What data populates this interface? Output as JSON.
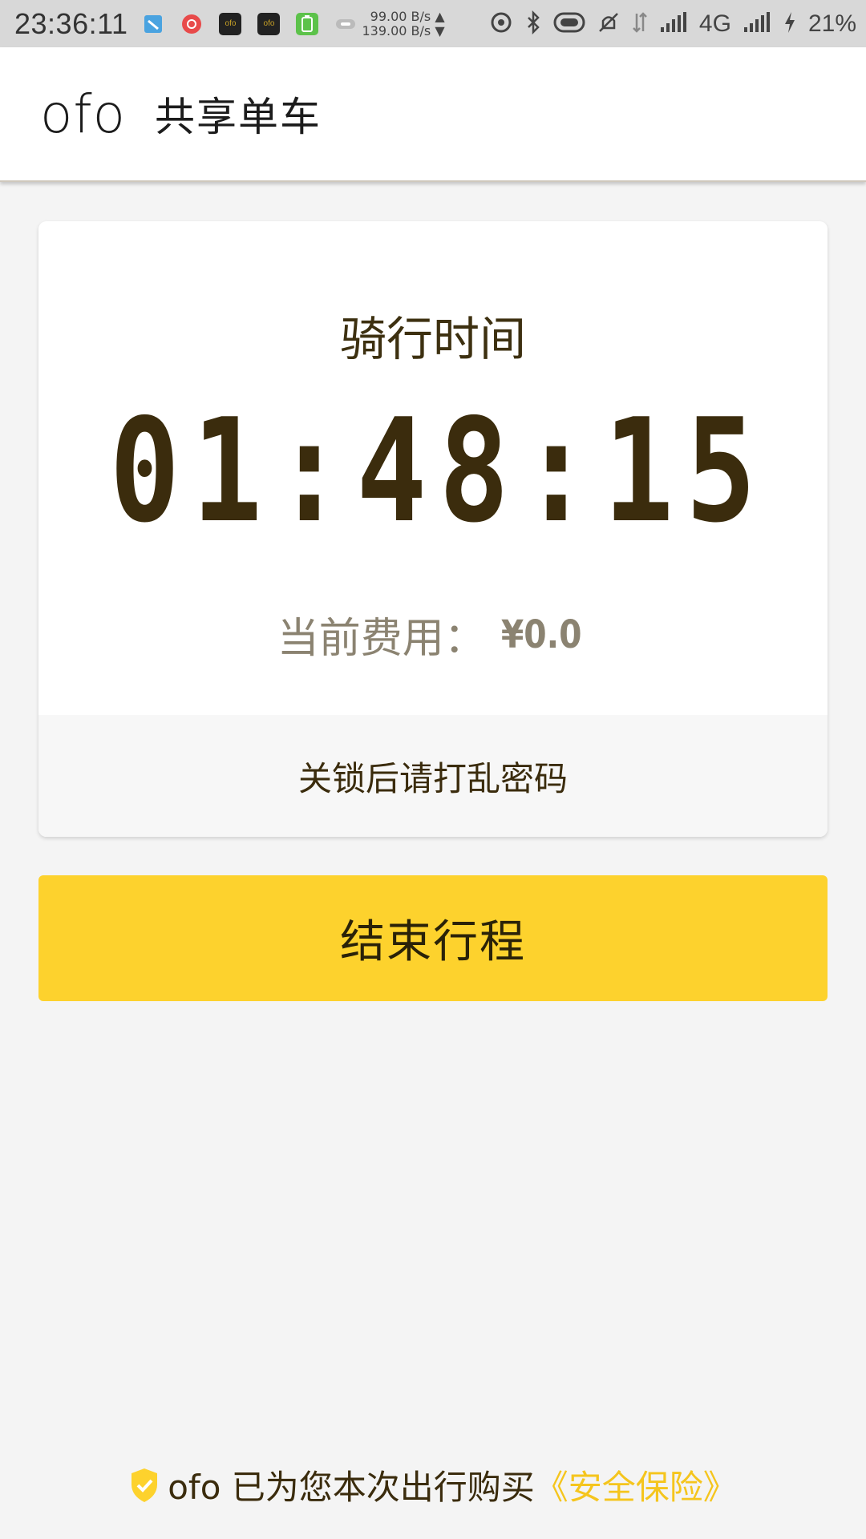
{
  "status_bar": {
    "time": "23:36:11",
    "speed_up": "99.00  B/s ▲",
    "speed_down": "139.00  B/s ▼",
    "network": "4G",
    "battery": "21%",
    "app_icon_text": "ofo"
  },
  "header": {
    "logo": "ofo",
    "title": "共享单车"
  },
  "ride": {
    "label": "骑行时间",
    "timer": "01:48:15",
    "fee_label": "当前费用：",
    "fee_value": "¥0.0",
    "notice": "关锁后请打乱密码"
  },
  "actions": {
    "end_trip": "结束行程"
  },
  "insurance": {
    "text": "ofo 已为您本次出行购买",
    "link": "《安全保险》"
  },
  "colors": {
    "accent": "#fdd22d",
    "text_dark": "#3b2c0d",
    "text_muted": "#8b8371",
    "link": "#f5c51d"
  },
  "icons": [
    "paste-icon",
    "music-icon",
    "ofo-app-icon",
    "battery-app-icon",
    "cast-icon",
    "hotspot-icon",
    "bluetooth-icon",
    "nfc-icon",
    "mute-icon",
    "signal-icon",
    "charging-icon",
    "shield-check-icon"
  ]
}
